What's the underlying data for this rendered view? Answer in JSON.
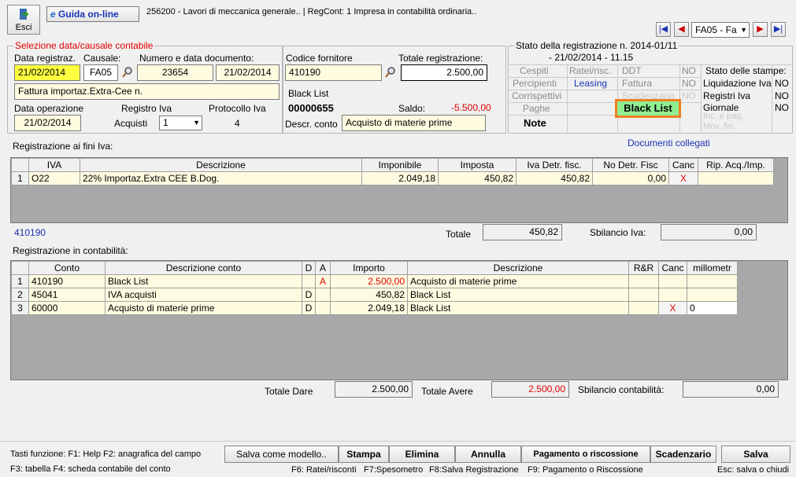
{
  "toolbar": {
    "esci_label": "Esci",
    "guida_label": "Guida on-line",
    "title_text": "256200 - Lavori di meccanica generale.. | RegCont: 1 Impresa  in contabilità ordinaria.."
  },
  "nav": {
    "causale_combo": "FA05 - Fa"
  },
  "selezione": {
    "title": "Selezione data/causale contabile",
    "data_reg_label": "Data registraz.",
    "data_reg": "21/02/2014",
    "causale_label": "Causale:",
    "causale": "FA05",
    "num_doc_label": "Numero e data documento:",
    "num_doc": "23654",
    "data_doc": "21/02/2014",
    "descrizione": "Fattura importaz.Extra-Cee n.",
    "data_op_label": "Data operazione",
    "data_op": "21/02/2014",
    "registro_label": "Registro Iva",
    "registro_value": "Acquisti",
    "registro_num": "1",
    "protocollo_label": "Protocollo Iva",
    "protocollo": "4"
  },
  "fornitore": {
    "codice_label": "Codice fornitore",
    "codice": "410190",
    "totale_label": "Totale registrazione:",
    "totale": "2.500,00",
    "nome": "Black List",
    "conto_num": "00000655",
    "saldo_label": "Saldo:",
    "saldo": "-5.500,00",
    "descr_conto_label": "Descr. conto",
    "descr_conto": "Acquisto di materie prime"
  },
  "stato": {
    "title": "Stato della registrazione n. 2014-01/11",
    "subtitle": "- 21/02/2014 - 11.15",
    "cespiti": "Cespiti",
    "ratei": "Ratei/risc.",
    "ddt": "DDT",
    "ddt_val": "NO",
    "percipienti": "Percipienti",
    "leasing": "Leasing",
    "fattura": "Fattura",
    "fattura_val": "NO",
    "corrispettivi": "Corrispettivi",
    "scadenzario": "Scadenzario",
    "scadenzario_val": "NO",
    "paghe": "Paghe",
    "black_list": "Black List",
    "note": "Note",
    "inc_pag": "Inc. e pag.",
    "mov_fin": "Mov. fin.",
    "stampe_title": "Stato delle stampe:",
    "liq_iva": "Liquidazione Iva",
    "liq_iva_val": "NO",
    "reg_iva": "Registri Iva",
    "reg_iva_val": "NO",
    "giornale": "Giornale",
    "giornale_val": "NO"
  },
  "documenti_collegati": "Documenti collegati",
  "iva": {
    "title": "Registrazione ai fini Iva:",
    "headers": [
      "",
      "IVA",
      "Descrizione",
      "Imponibile",
      "Imposta",
      "Iva Detr. fisc.",
      "No Detr. Fisc",
      "Canc",
      "Rip. Acq./Imp."
    ],
    "rows": [
      [
        "1",
        "O22",
        "22% Importaz.Extra CEE B.Dog.",
        "2.049,18",
        "450,82",
        "450,82",
        "0,00",
        "X",
        ""
      ]
    ],
    "conto_ref": "410190",
    "totale_label": "Totale",
    "totale": "450,82",
    "sbilancio_label": "Sbilancio Iva:",
    "sbilancio": "0,00"
  },
  "contabilita": {
    "title": "Registrazione in contabilità:",
    "headers": [
      "",
      "Conto",
      "Descrizione conto",
      "D",
      "A",
      "Importo",
      "Descrizione",
      "R&R",
      "Canc",
      "millometr"
    ],
    "rows": [
      [
        "1",
        "410190",
        "Black List",
        "",
        "A",
        "2.500,00",
        "Acquisto di materie prime",
        "",
        "",
        ""
      ],
      [
        "2",
        "45041",
        "IVA acquisti",
        "D",
        "",
        "450,82",
        "Black List",
        "",
        "",
        ""
      ],
      [
        "3",
        "60000",
        "Acquisto di materie prime",
        "D",
        "",
        "2.049,18",
        "Black List",
        "",
        "X",
        "0"
      ]
    ],
    "totale_dare_label": "Totale Dare",
    "totale_dare": "2.500,00",
    "totale_avere_label": "Totale Avere",
    "totale_avere": "2.500,00",
    "sbilancio_label": "Sbilancio contabilità:",
    "sbilancio": "0,00"
  },
  "footer": {
    "tasti_1": "Tasti funzione:  F1: Help   F2: anagrafica del campo",
    "tasti_2": "F3: tabella    F4: scheda contabile del conto",
    "salva_modello": "Salva come modello..",
    "stampa": "Stampa",
    "elimina": "Elimina",
    "annulla": "Annulla",
    "pagamento": "Pagamento o riscossione",
    "scadenzario": "Scadenzario",
    "salva": "Salva",
    "f6": "F6: Ratei/risconti",
    "f7": "F7:Spesometro",
    "f8": "F8:Salva Registrazione",
    "f9": "F9: Pagamento o Riscossione",
    "esc": "Esc: salva o chiudi"
  },
  "colors": {
    "yellow_field": "#ffff40",
    "cream": "#fffbe0",
    "red": "#e00000",
    "blue": "#1a33b5",
    "black_list_bg": "#90ee90",
    "black_list_border": "#f08020"
  }
}
